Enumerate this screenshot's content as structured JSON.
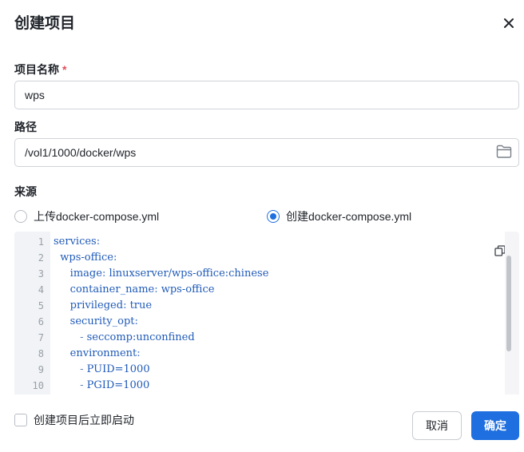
{
  "dialog": {
    "title": "创建项目"
  },
  "project_name": {
    "label": "项目名称",
    "required_mark": "*",
    "value": "wps"
  },
  "path": {
    "label": "路径",
    "value": "/vol1/1000/docker/wps"
  },
  "source": {
    "label": "来源",
    "options": [
      {
        "label": "上传docker-compose.yml",
        "selected": false
      },
      {
        "label": "创建docker-compose.yml",
        "selected": true
      }
    ]
  },
  "editor": {
    "line_numbers": [
      "1",
      "2",
      "3",
      "4",
      "5",
      "6",
      "7",
      "8",
      "9",
      "10"
    ],
    "lines": [
      {
        "indent": "",
        "key": "services",
        "sep": ":",
        "value": ""
      },
      {
        "indent": "  ",
        "key": "wps-office",
        "sep": ":",
        "value": ""
      },
      {
        "indent": "     ",
        "key": "image",
        "sep": ": ",
        "value": "linuxserver/wps-office:chinese"
      },
      {
        "indent": "     ",
        "key": "container_name",
        "sep": ": ",
        "value": "wps-office"
      },
      {
        "indent": "     ",
        "key": "privileged",
        "sep": ": ",
        "value": "true"
      },
      {
        "indent": "     ",
        "key": "security_opt",
        "sep": ":",
        "value": ""
      },
      {
        "indent": "        ",
        "key": "- ",
        "sep": "",
        "value": "seccomp:unconfined"
      },
      {
        "indent": "     ",
        "key": "environment",
        "sep": ":",
        "value": ""
      },
      {
        "indent": "        ",
        "key": "- ",
        "sep": "",
        "value": "PUID=1000"
      },
      {
        "indent": "        ",
        "key": "- ",
        "sep": "",
        "value": "PGID=1000"
      }
    ]
  },
  "footer": {
    "autostart_label": "创建项目后立即启动",
    "cancel_label": "取消",
    "confirm_label": "确定"
  },
  "colors": {
    "primary": "#1f6fe0",
    "required": "#e34d59"
  }
}
